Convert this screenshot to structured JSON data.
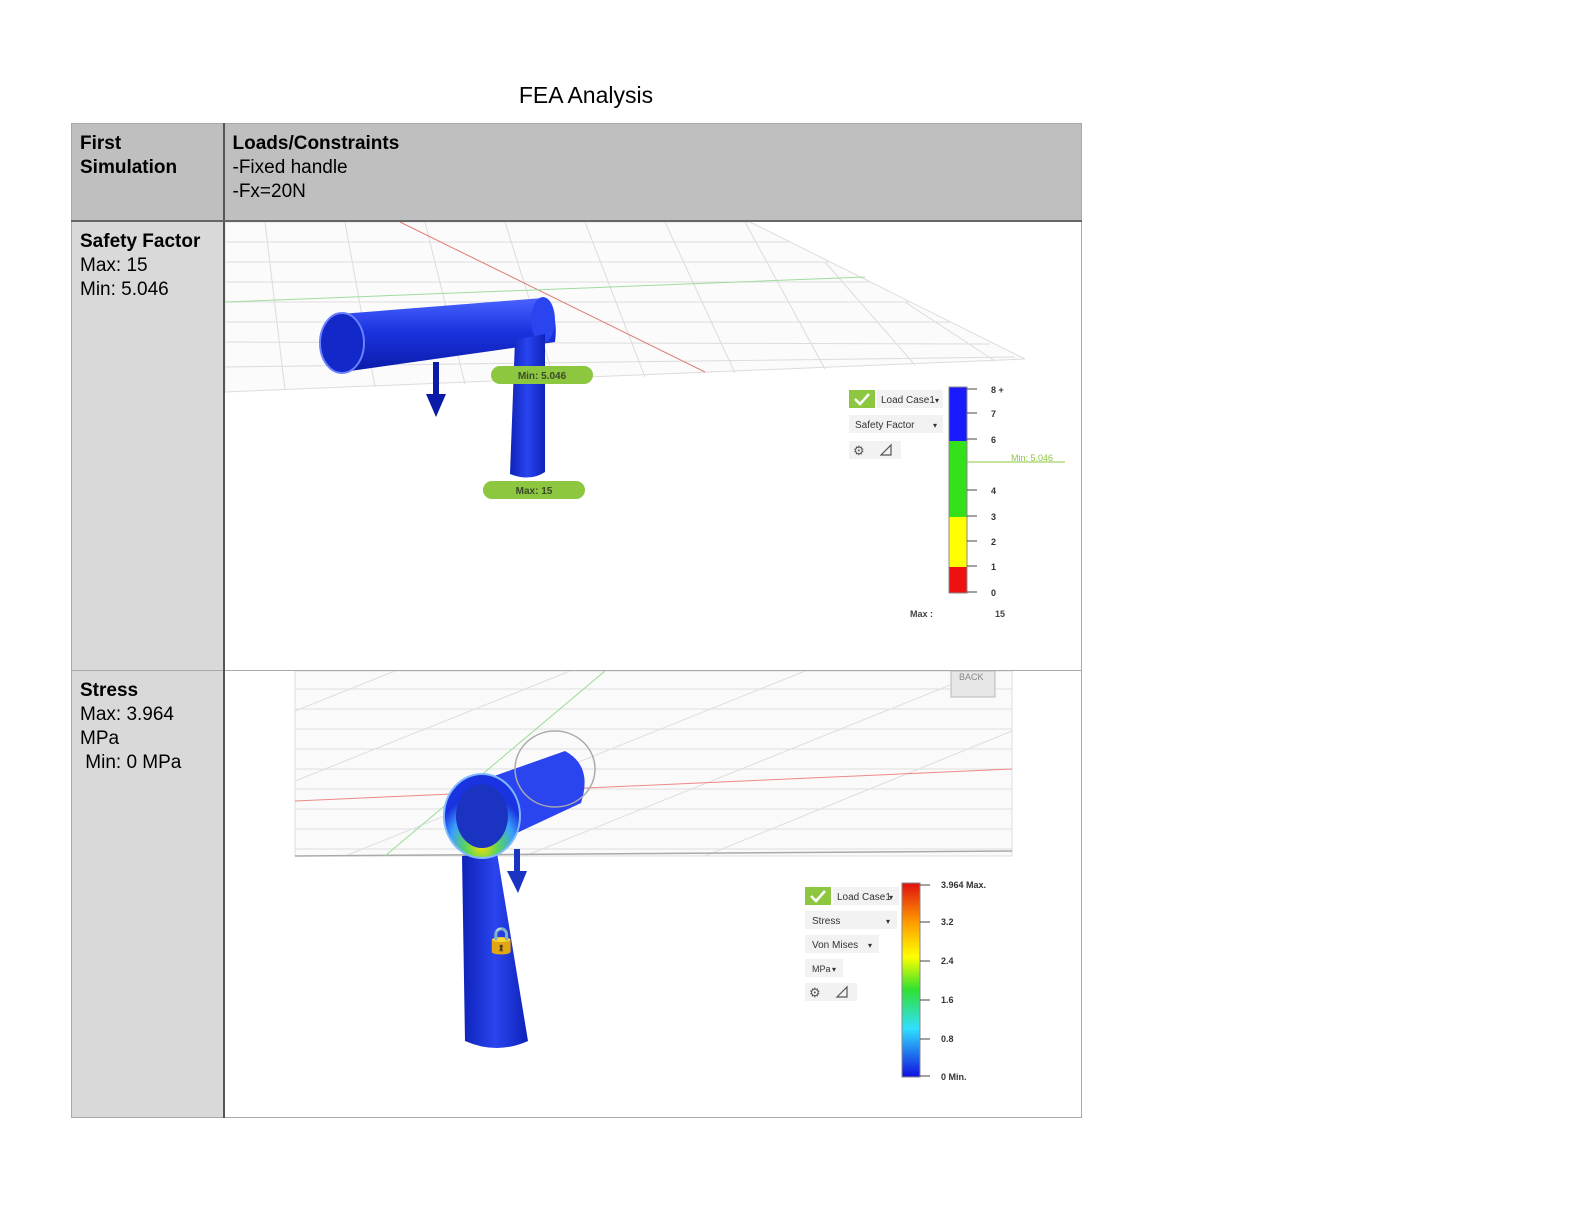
{
  "title": "FEA Analysis",
  "header": {
    "col1_line1": "First",
    "col1_line2": "Simulation",
    "col2_title": "Loads/Constraints",
    "col2_line1": "-Fixed handle",
    "col2_line2": "-Fx=20N"
  },
  "rows": [
    {
      "label": "Safety Factor",
      "line1": "Max: 15",
      "line2": "Min: 5.046",
      "viewer": {
        "min_tag": "Min: 5.046",
        "max_tag": "Max: 15",
        "load_case": "Load Case1",
        "result_type": "Safety Factor",
        "legend_ticks": [
          "8 +",
          "7",
          "6",
          "4",
          "3",
          "2",
          "1",
          "0"
        ],
        "legend_marker": "Min: 5.046",
        "max_label": "Max :",
        "max_value": "15"
      }
    },
    {
      "label": "Stress",
      "line1": "Max: 3.964",
      "line2": "MPa",
      "line3": " Min: 0 MPa",
      "viewer": {
        "viewcube": "BACK",
        "load_case": "Load Case1",
        "result_type": "Stress",
        "criterion": "Von Mises",
        "unit": "MPa",
        "legend_ticks": [
          "3.964 Max.",
          "3.2",
          "2.4",
          "1.6",
          "0.8",
          "0 Min."
        ]
      }
    }
  ],
  "colors": {
    "part_blue": "#1a33e0",
    "header_gray": "#bfbfbf",
    "label_gray": "#d9d9d9",
    "tag_green": "#8dc63f"
  }
}
